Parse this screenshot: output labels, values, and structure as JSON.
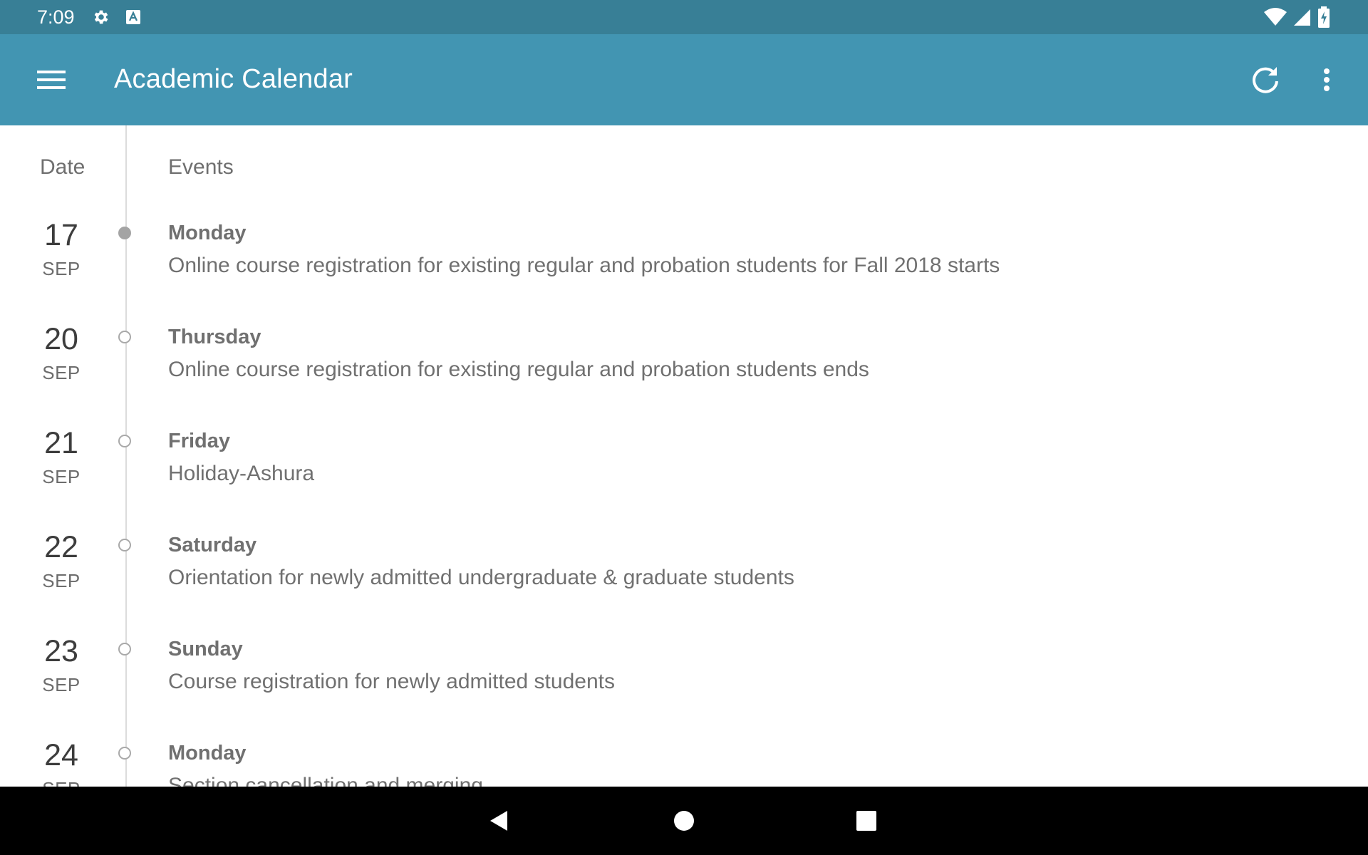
{
  "status_bar": {
    "time": "7:09",
    "icons": [
      "gear-icon",
      "a-icon",
      "wifi-icon",
      "signal-icon",
      "battery-icon"
    ]
  },
  "app_bar": {
    "title": "Academic Calendar",
    "actions": [
      "menu-icon",
      "refresh-icon",
      "more-vert-icon"
    ]
  },
  "table": {
    "date_header": "Date",
    "events_header": "Events",
    "rows": [
      {
        "day": "17",
        "month": "SEP",
        "weekday": "Monday",
        "event": "Online course registration for existing regular and probation students for  Fall 2018 starts",
        "active": true
      },
      {
        "day": "20",
        "month": "SEP",
        "weekday": "Thursday",
        "event": "Online course registration for existing regular and probation students ends",
        "active": false
      },
      {
        "day": "21",
        "month": "SEP",
        "weekday": "Friday",
        "event": "Holiday-Ashura",
        "active": false
      },
      {
        "day": "22",
        "month": "SEP",
        "weekday": "Saturday",
        "event": "Orientation for newly admitted undergraduate & graduate students",
        "active": false
      },
      {
        "day": "23",
        "month": "SEP",
        "weekday": "Sunday",
        "event": "Course registration for newly admitted students",
        "active": false
      },
      {
        "day": "24",
        "month": "SEP",
        "weekday": "Monday",
        "event": "Section cancellation and merging",
        "active": false
      }
    ]
  },
  "nav_bar": {
    "buttons": [
      "back-icon",
      "home-icon",
      "recents-icon"
    ]
  },
  "colors": {
    "status_bar": "#387f96",
    "app_bar": "#4295b2",
    "text_secondary": "#707070",
    "timeline": "#dcdcdc"
  }
}
